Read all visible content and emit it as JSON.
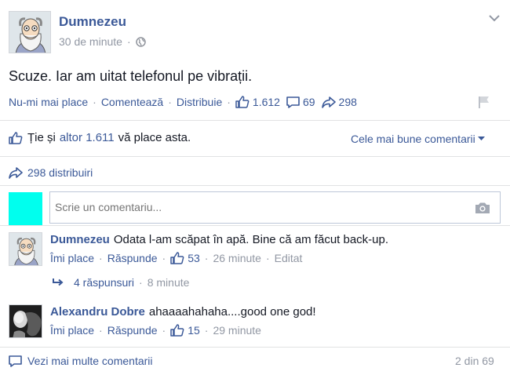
{
  "post": {
    "author": "Dumnezeu",
    "time": "30 de minute",
    "text": "Scuze. Iar am uitat telefonul pe vibrații.",
    "actions": {
      "unlike": "Nu-mi mai place",
      "comment": "Comentează",
      "share": "Distribuie"
    },
    "counts": {
      "likes": "1.612",
      "comments": "69",
      "shares": "298"
    }
  },
  "likes_bar": {
    "prefix": "Ție și",
    "others": "altor 1.611",
    "suffix": "vă place asta.",
    "sort_label": "Cele mai bune comentarii"
  },
  "shares_bar": {
    "label": "298 distribuiri"
  },
  "composer": {
    "placeholder": "Scrie un comentariu..."
  },
  "comments": [
    {
      "author": "Dumnezeu",
      "text": "Odata l-am scăpat în apă. Bine că am făcut back-up.",
      "like": "Îmi place",
      "reply": "Răspunde",
      "likes": "53",
      "time": "26 minute",
      "edited": "Editat",
      "replies": "4 răspunsuri",
      "replies_time": "8 minute"
    },
    {
      "author": "Alexandru Dobre",
      "text": "ahaaaahahaha....good one god!",
      "like": "Îmi place",
      "reply": "Răspunde",
      "likes": "15",
      "time": "29 minute"
    }
  ],
  "footer": {
    "more": "Vezi mai multe comentarii",
    "pager": "2 din 69"
  },
  "colors": {
    "link": "#3b5998",
    "composer_avatar": "#00ffee"
  }
}
